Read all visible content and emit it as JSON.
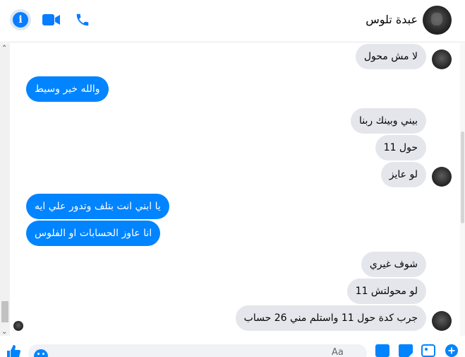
{
  "header": {
    "contact_name": "عبدة تلوس"
  },
  "composer": {
    "placeholder": "Aa"
  },
  "colors": {
    "accent": "#0084ff",
    "incoming_bubble": "#e4e6eb",
    "icon_blue": "#0a7cff"
  },
  "messages": [
    {
      "text": "لا مش محول"
    },
    {
      "text": "والله خير وسيط"
    },
    {
      "text": "بيني وبينك ربنا"
    },
    {
      "text": "حول 11"
    },
    {
      "text": "لو عايز"
    },
    {
      "text": "يا ابني انت بتلف وتدور علي ايه"
    },
    {
      "text": "انا عاوز الحسابات او الفلوس"
    },
    {
      "text": "شوف غيري"
    },
    {
      "text": "لو محولتش 11"
    },
    {
      "text": "جرب كدة حول 11 واستلم مني 26 حساب"
    }
  ]
}
